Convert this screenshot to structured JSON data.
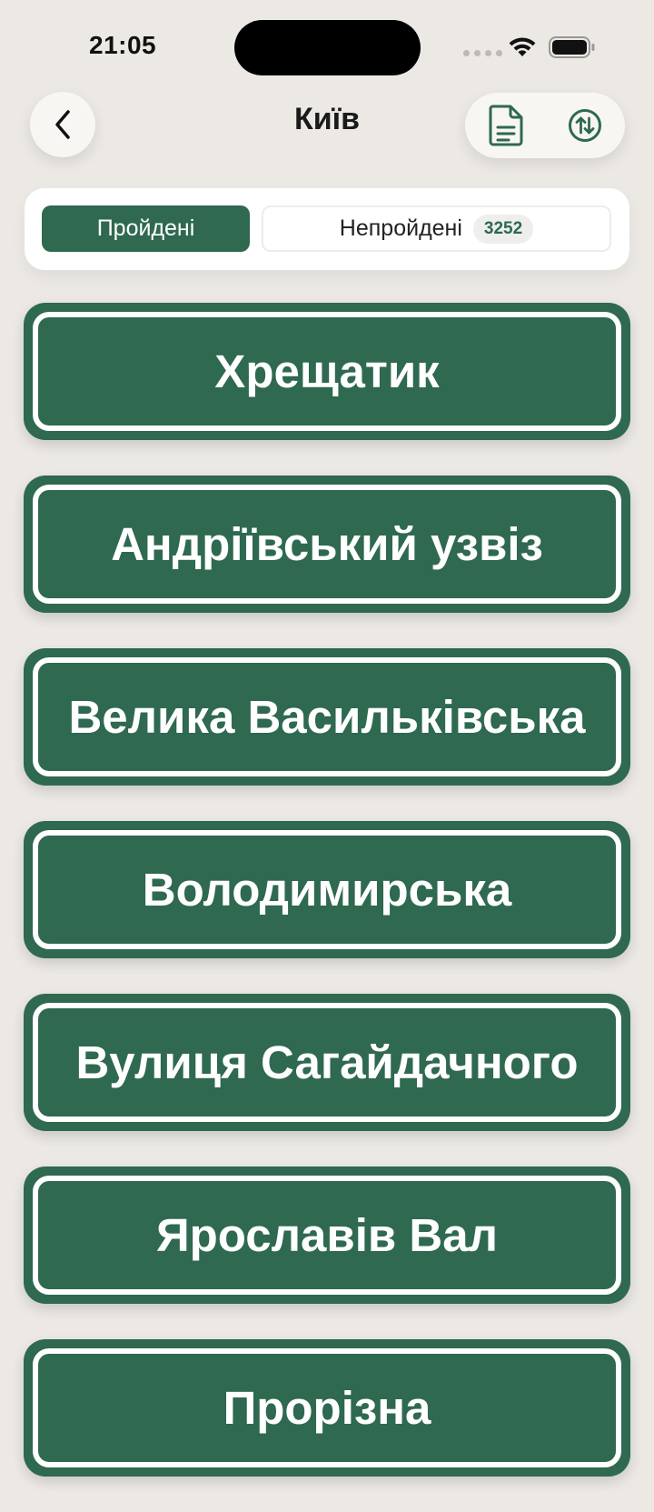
{
  "status_bar": {
    "time": "21:05",
    "icons": [
      "signal-dots-icon",
      "wifi-icon",
      "battery-icon"
    ]
  },
  "header": {
    "title": "Київ",
    "back_icon": "chevron-left-icon",
    "actions": [
      "document-icon",
      "sort-arrows-icon"
    ]
  },
  "segments": {
    "passed_label": "Пройдені",
    "unpassed_label": "Непройдені",
    "unpassed_count": "3252",
    "selected": "passed"
  },
  "streets": [
    {
      "name": "Хрещатик"
    },
    {
      "name": "Андріївський узвіз"
    },
    {
      "name": "Велика Васильківська"
    },
    {
      "name": "Володимирська"
    },
    {
      "name": "Вулиця Сагайдачного"
    },
    {
      "name": "Ярославів Вал"
    },
    {
      "name": "Прорізна"
    }
  ],
  "colors": {
    "accent": "#2e6950",
    "background": "#ece9e5",
    "card": "#ffffff"
  }
}
